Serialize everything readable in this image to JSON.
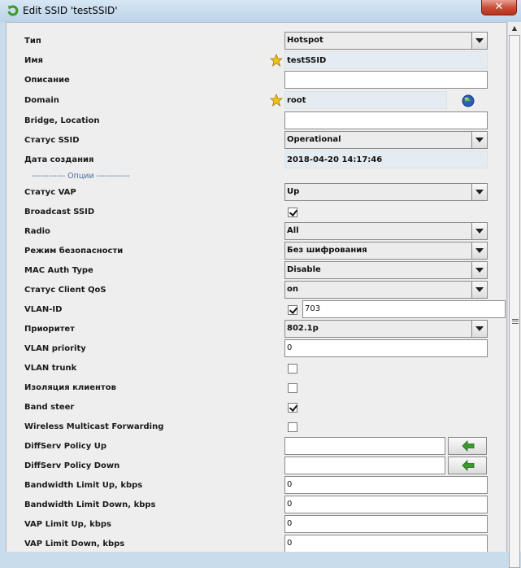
{
  "window": {
    "title": "Edit SSID 'testSSID'",
    "close_label": "✕"
  },
  "section_options": "------------ Опции ------------",
  "fields": [
    {
      "label": "Тип",
      "value": "Hotspot"
    },
    {
      "label": "Имя",
      "value": "testSSID"
    },
    {
      "label": "Описание",
      "value": ""
    },
    {
      "label": "Domain",
      "value": "root"
    },
    {
      "label": "Bridge, Location",
      "value": ""
    },
    {
      "label": "Статус SSID",
      "value": "Operational"
    },
    {
      "label": "Дата создания",
      "value": "2018-04-20 14:17:46"
    },
    {
      "label": "Статус VAP",
      "value": "Up"
    },
    {
      "label": "Broadcast SSID",
      "checked": true
    },
    {
      "label": "Radio",
      "value": "All"
    },
    {
      "label": "Режим безопасности",
      "value": "Без шифрования"
    },
    {
      "label": "MAC Auth Type",
      "value": "Disable"
    },
    {
      "label": "Статус Client QoS",
      "value": "on"
    },
    {
      "label": "VLAN-ID",
      "checked": true,
      "value": "703"
    },
    {
      "label": "Приоритет",
      "value": "802.1p"
    },
    {
      "label": "VLAN priority",
      "value": "0"
    },
    {
      "label": "VLAN trunk",
      "checked": false
    },
    {
      "label": "Изоляция клиентов",
      "checked": false
    },
    {
      "label": "Band steer",
      "checked": true
    },
    {
      "label": "Wireless Multicast Forwarding",
      "checked": false
    },
    {
      "label": "DiffServ Policy Up",
      "value": ""
    },
    {
      "label": "DiffServ Policy Down",
      "value": ""
    },
    {
      "label": "Bandwidth Limit Up, kbps",
      "value": "0"
    },
    {
      "label": "Bandwidth Limit Down, kbps",
      "value": "0"
    },
    {
      "label": "VAP Limit Up, kbps",
      "value": "0"
    },
    {
      "label": "VAP Limit Down, kbps",
      "value": "0"
    }
  ],
  "icons": {
    "app": "green-refresh-icon",
    "required": "star-icon",
    "domain_picker": "globe-icon",
    "diffserv_select": "green-left-arrow-icon"
  },
  "colors": {
    "title_bar": "#c9dcec",
    "close": "#c75039",
    "section": "#4a6fa5",
    "star": "#f2c418"
  }
}
